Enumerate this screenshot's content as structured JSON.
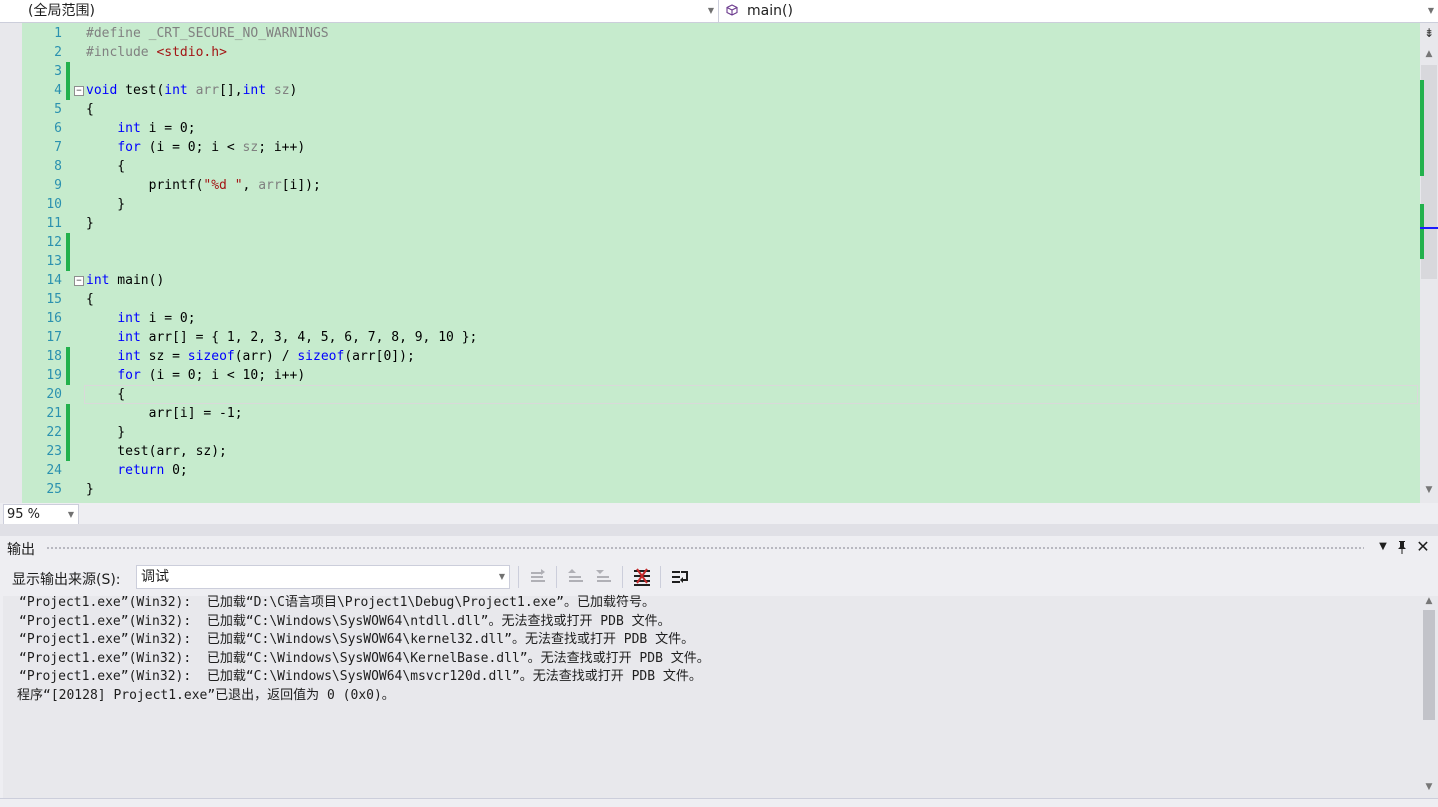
{
  "nav": {
    "scope": "(全局范围)",
    "member": "main()"
  },
  "editor": {
    "lines": [
      {
        "n": "1",
        "html": "<span class='pp'>#define</span> <span class='pp'>_CRT_SECURE_NO_WARNINGS</span>"
      },
      {
        "n": "2",
        "html": "<span class='pp'>#include</span> <span class='inc'>&lt;stdio.h&gt;</span>"
      },
      {
        "n": "3",
        "html": "",
        "chg": true
      },
      {
        "n": "4",
        "html": "<span class='kw'>void</span> test(<span class='kw'>int</span> <span class='par'>arr</span>[],<span class='kw'>int</span> <span class='par'>sz</span>)",
        "chg": true,
        "fold": true
      },
      {
        "n": "5",
        "html": "{"
      },
      {
        "n": "6",
        "html": "    <span class='kw'>int</span> i = 0;"
      },
      {
        "n": "7",
        "html": "    <span class='kw'>for</span> (i = 0; i &lt; <span class='par'>sz</span>; i++)"
      },
      {
        "n": "8",
        "html": "    {"
      },
      {
        "n": "9",
        "html": "        printf(<span class='str'>\"%d \"</span>, <span class='par'>arr</span>[i]);"
      },
      {
        "n": "10",
        "html": "    }"
      },
      {
        "n": "11",
        "html": "}"
      },
      {
        "n": "12",
        "html": "",
        "chg": true
      },
      {
        "n": "13",
        "html": "",
        "chg": true
      },
      {
        "n": "14",
        "html": "<span class='kw'>int</span> main()",
        "fold": true
      },
      {
        "n": "15",
        "html": "{"
      },
      {
        "n": "16",
        "html": "    <span class='kw'>int</span> i = 0;"
      },
      {
        "n": "17",
        "html": "    <span class='kw'>int</span> arr[] = { 1, 2, 3, 4, 5, 6, 7, 8, 9, 10 };"
      },
      {
        "n": "18",
        "html": "    <span class='kw'>int</span> sz = <span class='kw'>sizeof</span>(arr) / <span class='kw'>sizeof</span>(arr[0]);",
        "chg": true
      },
      {
        "n": "19",
        "html": "    <span class='kw'>for</span> (i = 0; i &lt; 10; i++)",
        "chg": true
      },
      {
        "n": "20",
        "html": "    {",
        "cur": true
      },
      {
        "n": "21",
        "html": "        arr[i] = -1;",
        "chg": true
      },
      {
        "n": "22",
        "html": "    }",
        "chg": true
      },
      {
        "n": "23",
        "html": "    test(arr, sz);",
        "chg": true
      },
      {
        "n": "24",
        "html": "    <span class='kw'>return</span> 0;"
      },
      {
        "n": "25",
        "html": "}"
      }
    ]
  },
  "status": {
    "zoom": "95 %"
  },
  "output": {
    "title": "输出",
    "source_label": "显示输出来源(S):",
    "source_value": "调试",
    "lines": [
      "“Project1.exe”(Win32):  已加载“D:\\C语言项目\\Project1\\Debug\\Project1.exe”。已加载符号。",
      "“Project1.exe”(Win32):  已加载“C:\\Windows\\SysWOW64\\ntdll.dll”。无法查找或打开 PDB 文件。",
      "“Project1.exe”(Win32):  已加载“C:\\Windows\\SysWOW64\\kernel32.dll”。无法查找或打开 PDB 文件。",
      "“Project1.exe”(Win32):  已加载“C:\\Windows\\SysWOW64\\KernelBase.dll”。无法查找或打开 PDB 文件。",
      "“Project1.exe”(Win32):  已加载“C:\\Windows\\SysWOW64\\msvcr120d.dll”。无法查找或打开 PDB 文件。",
      "程序“[20128] Project1.exe”已退出，返回值为 0 (0x0)。"
    ]
  },
  "colors": {
    "editor_bg": "#c6ebcd",
    "change_bar": "#22b14c",
    "keyword": "#0000ff",
    "line_number": "#2b91af"
  }
}
